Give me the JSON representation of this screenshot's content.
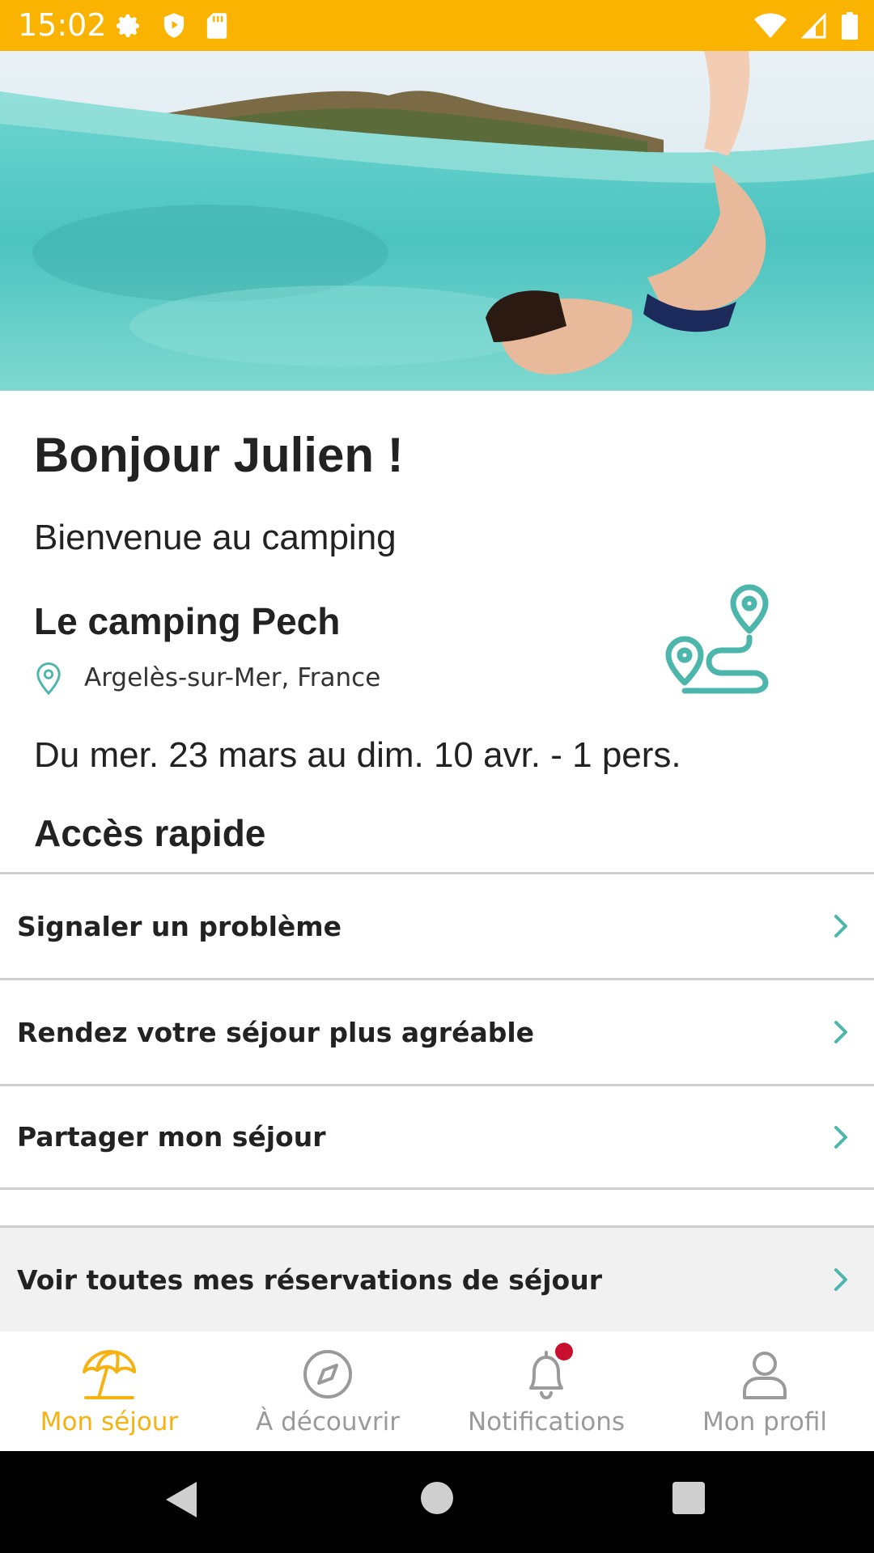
{
  "status_bar": {
    "time": "15:02",
    "background": "#F9B300",
    "left_icons": [
      "gear-icon",
      "shield-icon",
      "sd-card-icon"
    ],
    "right_icons": [
      "wifi-icon",
      "signal-icon",
      "battery-icon"
    ]
  },
  "hero": {
    "image_description_icon": "swimmer-photo",
    "carousel_index": 1
  },
  "greeting": "Bonjour Julien !",
  "welcome": "Bienvenue au camping",
  "camping": {
    "name": "Le camping Pech",
    "location": "Argelès-sur-Mer, France",
    "location_icon": "map-pin-icon",
    "illustration_icon": "route-icon"
  },
  "stay": {
    "dates": "Du mer. 23 mars au dim. 10 avr. - 1 pers."
  },
  "quick_access": {
    "title": "Accès rapide",
    "items": [
      {
        "label": "Signaler un problème"
      },
      {
        "label": "Rendez votre séjour plus agréable"
      },
      {
        "label": "Partager mon séjour"
      }
    ],
    "all_reservations": "Voir toutes mes réservations de séjour"
  },
  "bottom_nav": {
    "items": [
      {
        "label": "Mon séjour",
        "icon": "beach-umbrella-icon",
        "active": true
      },
      {
        "label": "À découvrir",
        "icon": "compass-icon",
        "active": false
      },
      {
        "label": "Notifications",
        "icon": "bell-icon",
        "active": false,
        "badge": true
      },
      {
        "label": "Mon profil",
        "icon": "user-icon",
        "active": false
      }
    ]
  },
  "colors": {
    "accent": "#F5B210",
    "teal": "#4DB6AC",
    "notification_badge": "#C8102E"
  }
}
